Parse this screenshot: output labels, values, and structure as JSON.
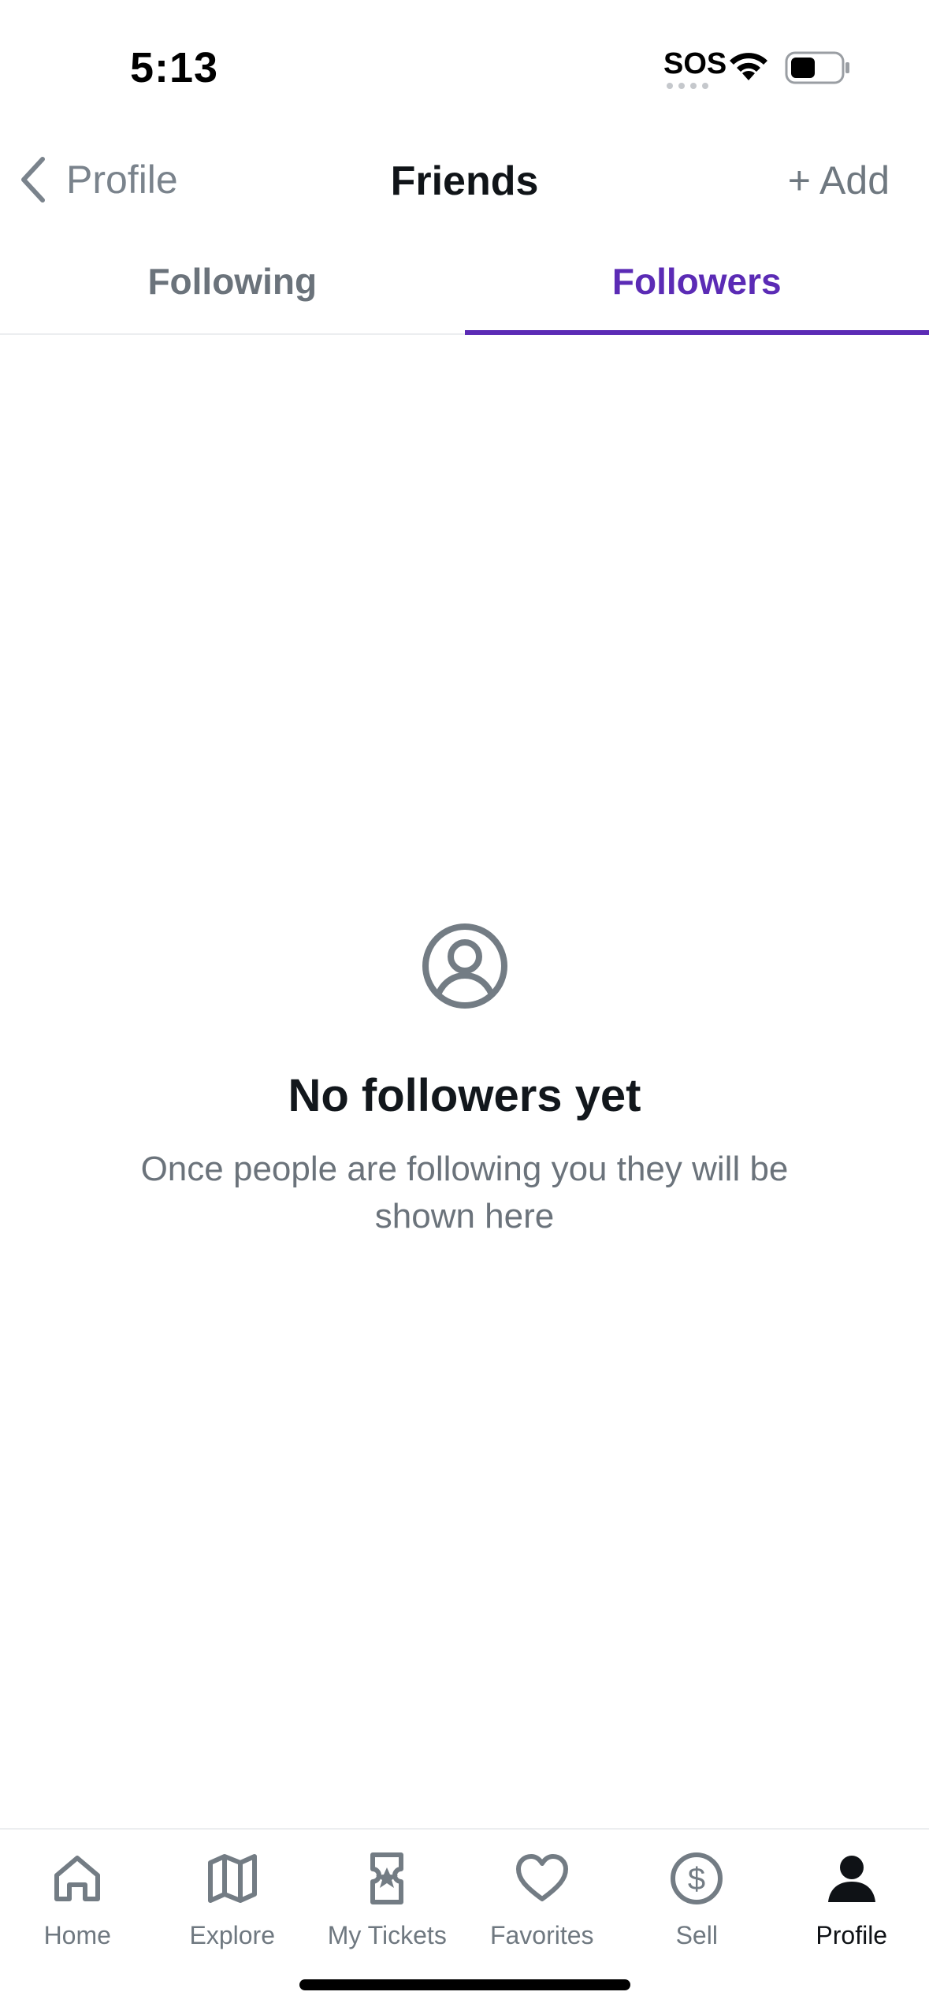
{
  "status_bar": {
    "time": "5:13",
    "carrier": "SOS"
  },
  "nav": {
    "back_label": "Profile",
    "title": "Friends",
    "add_label": "+ Add"
  },
  "tabs": [
    {
      "label": "Following",
      "active": false
    },
    {
      "label": "Followers",
      "active": true
    }
  ],
  "empty_state": {
    "icon": "user-circle-icon",
    "title": "No followers yet",
    "message": "Once people are following you they will be shown here"
  },
  "bottom_nav": {
    "items": [
      {
        "label": "Home",
        "icon": "home-icon"
      },
      {
        "label": "Explore",
        "icon": "map-icon"
      },
      {
        "label": "My Tickets",
        "icon": "ticket-icon"
      },
      {
        "label": "Favorites",
        "icon": "heart-icon"
      },
      {
        "label": "Sell",
        "icon": "dollar-icon"
      },
      {
        "label": "Profile",
        "icon": "person-icon",
        "active": true
      }
    ]
  },
  "colors": {
    "accent": "#5b2bb5",
    "muted_text": "#6b737b",
    "title_text": "#12171c"
  }
}
